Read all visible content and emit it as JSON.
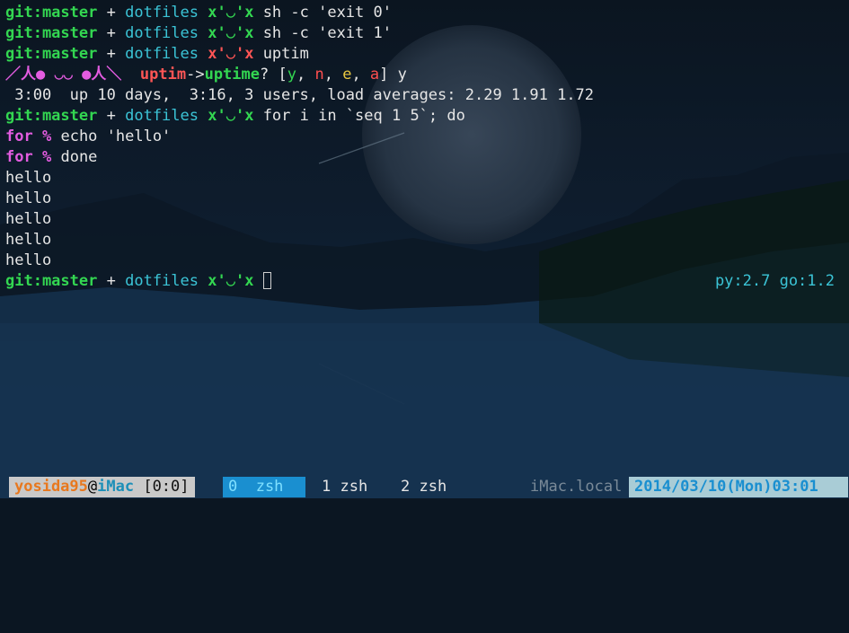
{
  "prompt": {
    "git_prefix": "git:master",
    "plus": "+",
    "dir": "dotfiles",
    "face_ok": "x'◡'x",
    "face_err": "x'◡'x"
  },
  "lines": {
    "cmd1": "sh -c 'exit 0'",
    "cmd2": "sh -c 'exit 1'",
    "cmd3": "uptim",
    "correct_face": "／人● ◡◡ ●人＼",
    "correct_word": "uptim",
    "correct_arrow": "->",
    "correct_to": "uptime",
    "correct_q": "? [",
    "opt_y": "y",
    "opt_n": "n",
    "opt_e": "e",
    "opt_a": "a",
    "correct_end": "] y",
    "uptime_out": " 3:00  up 10 days,  3:16, 3 users, load averages: 2.29 1.91 1.72",
    "cmd4": "for i in `seq 1 5`; do",
    "for_kw": "for",
    "pct": "%",
    "body1": "echo 'hello'",
    "body2": "done",
    "out": [
      "hello",
      "hello",
      "hello",
      "hello",
      "hello"
    ]
  },
  "rprompt": "py:2.7 go:1.2",
  "status": {
    "user": "yosida95",
    "at": "@",
    "host": "iMac",
    "pane": " [0:0]",
    "win0": "0  zsh",
    "win1": "1 zsh",
    "win2": "2 zsh",
    "local": "iMac.local",
    "date": "2014/03/10(Mon)03:01"
  }
}
